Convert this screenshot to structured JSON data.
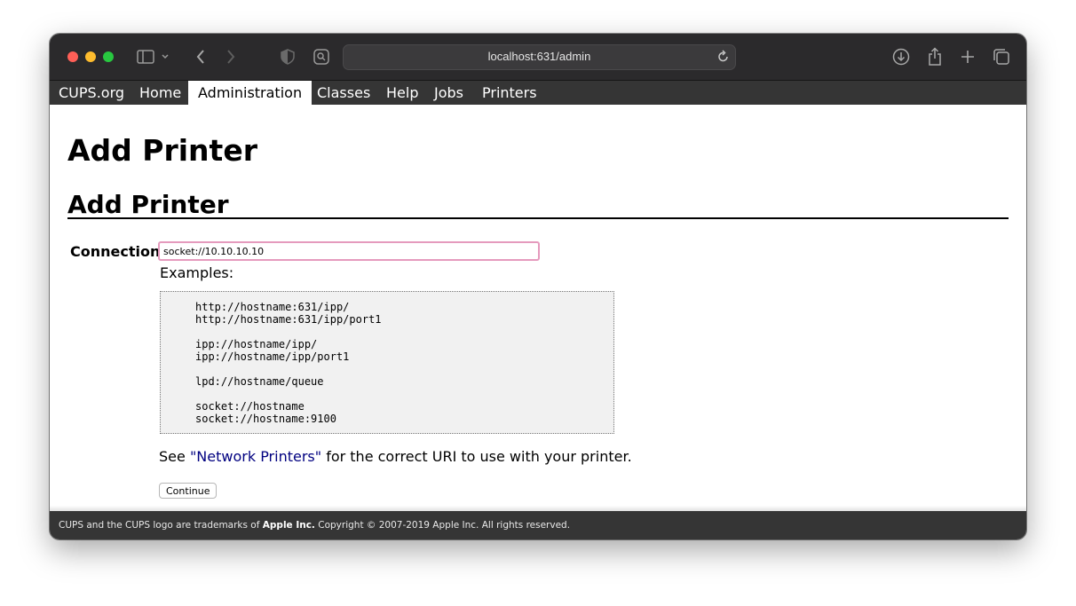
{
  "browser": {
    "url": "localhost:631/admin",
    "icons": [
      "sidebar-toggle-icon",
      "chevron-down-icon",
      "back-arrow-icon",
      "forward-arrow-icon",
      "privacy-shield-icon",
      "reader-icon",
      "reload-icon",
      "download-icon",
      "share-icon",
      "new-tab-plus-icon",
      "tab-overview-icon"
    ]
  },
  "nav": {
    "items": [
      "CUPS.org",
      "Home",
      "Administration",
      "Classes",
      "Help",
      "Jobs",
      "Printers"
    ],
    "active": "Administration"
  },
  "page": {
    "title": "Add Printer",
    "section_title": "Add Printer"
  },
  "form": {
    "connection_label": "Connection:",
    "connection_value": "socket://10.10.10.10",
    "examples_label": "Examples:",
    "examples": [
      "http://hostname:631/ipp/",
      "http://hostname:631/ipp/port1",
      "ipp://hostname/ipp/",
      "ipp://hostname/ipp/port1",
      "lpd://hostname/queue",
      "socket://hostname",
      "socket://hostname:9100"
    ],
    "see_prefix": "See ",
    "see_link": "\"Network Printers\"",
    "see_suffix": " for the correct URI to use with your printer.",
    "continue_label": "Continue"
  },
  "footer": {
    "prefix": "CUPS and the CUPS logo are trademarks of ",
    "company": "Apple Inc.",
    "suffix": " Copyright © 2007-2019 Apple Inc. All rights reserved."
  },
  "colors": {
    "close": "#ff5f57",
    "minimize": "#febc2e",
    "zoom": "#28c840",
    "input_focus": "#e59abd",
    "link": "#000080",
    "nav_bg": "#353535"
  }
}
